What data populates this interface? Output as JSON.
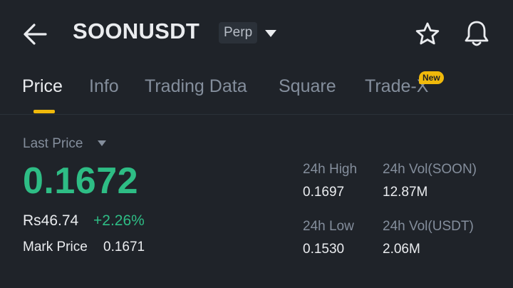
{
  "header": {
    "symbol": "SOONUSDT",
    "contract_type": "Perp",
    "icons": {
      "back": "arrow-left-icon",
      "dropdown": "caret-down-icon",
      "favorite": "star-icon",
      "alerts": "bell-icon"
    }
  },
  "tabs": [
    {
      "label": "Price",
      "active": true
    },
    {
      "label": "Info",
      "active": false
    },
    {
      "label": "Trading Data",
      "active": false
    },
    {
      "label": "Square",
      "active": false
    },
    {
      "label": "Trade-X",
      "active": false,
      "badge": "New"
    }
  ],
  "price": {
    "label": "Last Price",
    "last": "0.1672",
    "fiat": "Rs46.74",
    "change_pct": "+2.26%",
    "mark_label": "Mark Price",
    "mark_value": "0.1671"
  },
  "stats": {
    "high_label": "24h High",
    "high": "0.1697",
    "low_label": "24h Low",
    "low": "0.1530",
    "vol_base_label": "24h Vol(SOON)",
    "vol_base": "12.87M",
    "vol_quote_label": "24h Vol(USDT)",
    "vol_quote": "2.06M"
  },
  "colors": {
    "background": "#1f2329",
    "up": "#2ebd85",
    "accent": "#f0b90b",
    "muted": "#848e9c",
    "text": "#eaecef"
  }
}
